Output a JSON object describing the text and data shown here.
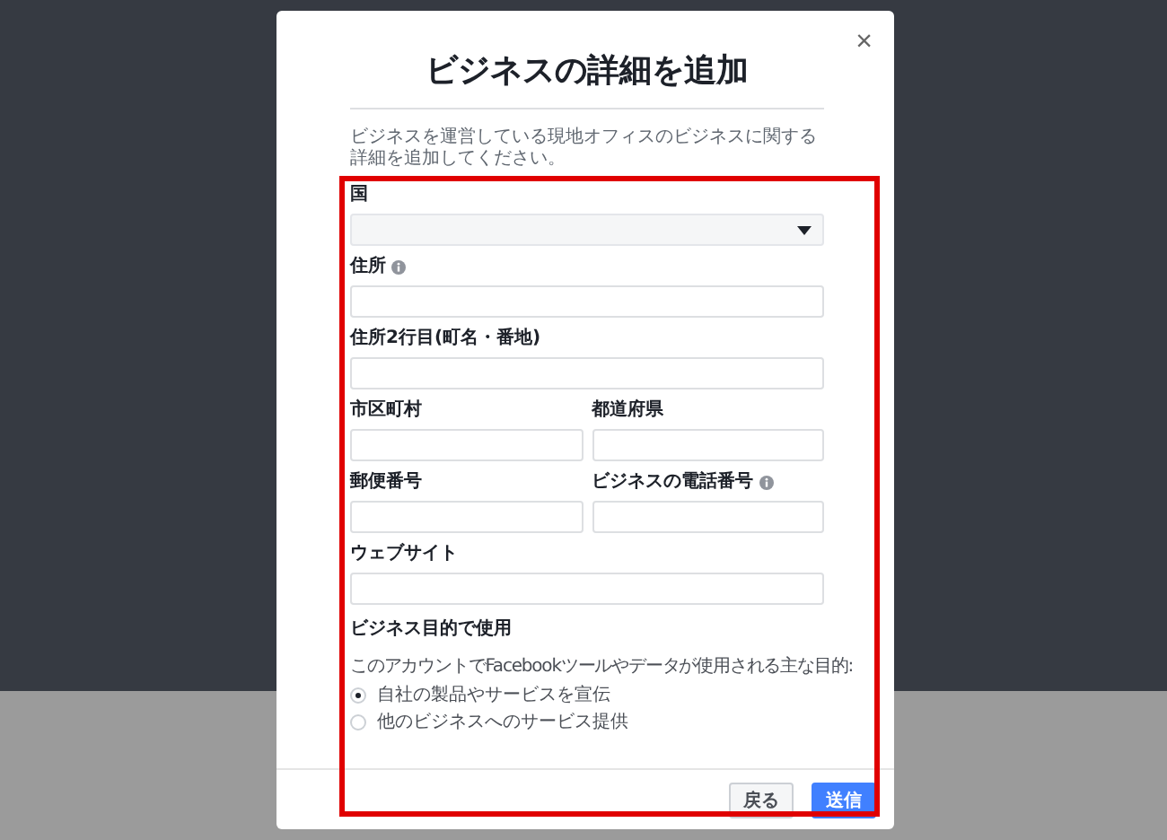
{
  "dialog": {
    "title": "ビジネスの詳細を追加",
    "close": "×",
    "description": "ビジネスを運営している現地オフィスのビジネスに関する詳細を追加してください。",
    "rows": [
      {
        "fields": [
          {
            "label": "国",
            "kind": "select",
            "info": false
          }
        ]
      },
      {
        "fields": [
          {
            "label": "住所",
            "kind": "text",
            "info": true
          }
        ]
      },
      {
        "fields": [
          {
            "label": "住所2行目(町名・番地)",
            "kind": "text",
            "info": false
          }
        ]
      },
      {
        "fields": [
          {
            "label": "市区町村",
            "kind": "text",
            "info": false
          },
          {
            "label": "都道府県",
            "kind": "text",
            "info": false
          }
        ]
      },
      {
        "fields": [
          {
            "label": "郵便番号",
            "kind": "text",
            "info": false
          },
          {
            "label": "ビジネスの電話番号",
            "kind": "text",
            "info": true
          }
        ]
      },
      {
        "fields": [
          {
            "label": "ウェブサイト",
            "kind": "text",
            "info": false
          }
        ]
      }
    ],
    "purpose": {
      "heading": "ビジネス目的で使用",
      "question": "このアカウントでFacebookツールやデータが使用される主な目的:",
      "options": [
        {
          "label": "自社の製品やサービスを宣伝",
          "selected": true
        },
        {
          "label": "他のビジネスへのサービス提供",
          "selected": false
        }
      ]
    },
    "buttons": [
      {
        "label": "戻る",
        "kind": "secondary"
      },
      {
        "label": "送信",
        "kind": "primary"
      }
    ]
  }
}
